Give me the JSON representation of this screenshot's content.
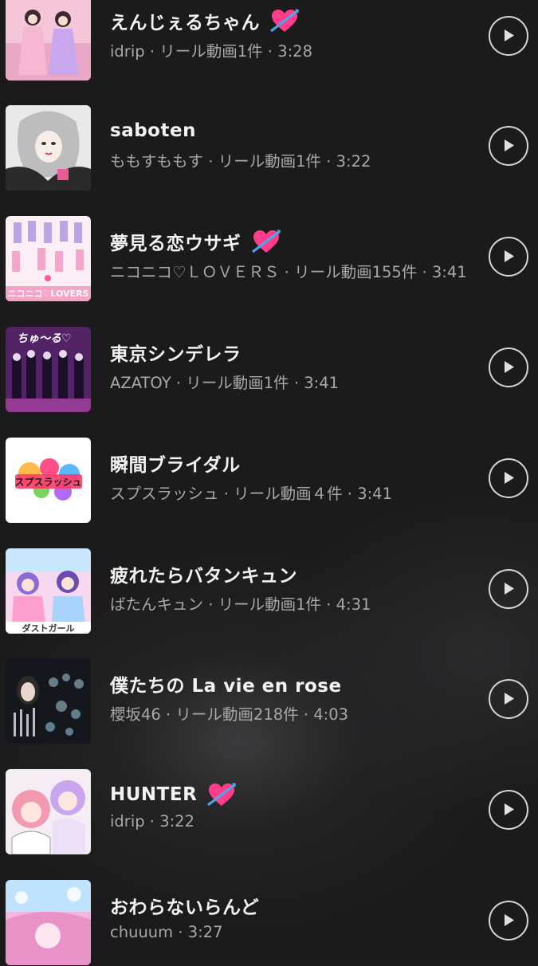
{
  "tracks": [
    {
      "title": "えんじぇるちゃん",
      "heart": true,
      "subtitle": "idrip · リール動画1件 · 3:28",
      "thumb_label": ""
    },
    {
      "title": "saboten",
      "heart": false,
      "subtitle": "ももすももす · リール動画1件 · 3:22",
      "thumb_label": ""
    },
    {
      "title": "夢見る恋ウサギ",
      "heart": true,
      "subtitle": "ニコニコ♡ＬＯＶＥＲＳ · リール動画155件 · 3:41",
      "thumb_label": "ニコニコ♡LOVERS"
    },
    {
      "title": "東京シンデレラ",
      "heart": false,
      "subtitle": "AZATOY · リール動画1件 · 3:41",
      "thumb_label": "ちゅ〜る♡"
    },
    {
      "title": "瞬間ブライダル",
      "heart": false,
      "subtitle": "スプスラッシュ · リール動画４件 · 3:41",
      "thumb_label": "スプスラッシュ"
    },
    {
      "title": "疲れたらバタンキュン",
      "heart": false,
      "subtitle": "ばたんキュン · リール動画1件 · 4:31",
      "thumb_label": "ダストガール"
    },
    {
      "title": "僕たちの La vie en rose",
      "heart": false,
      "subtitle": "櫻坂46 · リール動画218件 · 4:03",
      "thumb_label": ""
    },
    {
      "title": "HUNTER",
      "heart": true,
      "subtitle": "idrip · 3:22",
      "thumb_label": ""
    },
    {
      "title": "おわらないらんど",
      "heart": false,
      "subtitle": "chuuum · 3:27",
      "thumb_label": ""
    }
  ],
  "icons": {
    "play": "play-icon",
    "heart": "heart-with-arrow-emoji"
  },
  "colors": {
    "background": "#1b1b1c",
    "title_text": "#f2f2f2",
    "subtitle_text": "#a8a8a8",
    "play_ring": "#d6d6d6",
    "heart": "#ff3d8b"
  }
}
